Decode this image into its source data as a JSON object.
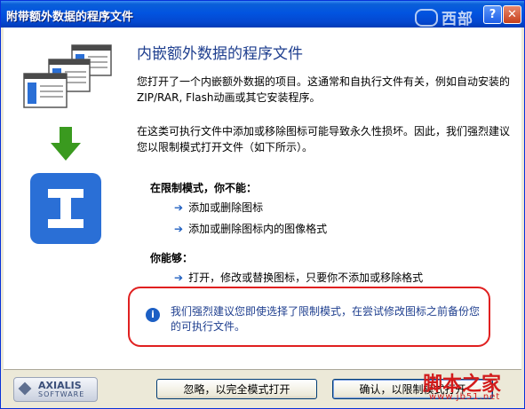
{
  "window": {
    "title": "附带额外数据的程序文件",
    "help_label": "?",
    "close_label": "✕",
    "brand": "西部"
  },
  "main": {
    "heading": "内嵌额外数据的程序文件",
    "paragraph1": "您打开了一个内嵌额外数据的项目。这通常和自执行文件有关，例如自动安装的ZIP/RAR, Flash动画或其它安装程序。",
    "paragraph2": "在这类可执行文件中添加或移除图标可能导致永久性损坏。因此，我们强烈建议您以限制模式打开文件（如下所示）。",
    "restricted_heading": "在限制模式，你不能：",
    "cannot_items": [
      "添加或删除图标",
      "添加或删除图标内的图像格式"
    ],
    "can_heading": "你能够：",
    "can_items": [
      "打开，修改或替换图标，只要你不添加或移除格式"
    ],
    "warning": "我们强烈建议您即使选择了限制模式，在尝试修改图标之前备份您的可执行文件。"
  },
  "footer": {
    "logo_line1": "AXIALIS",
    "logo_line2": "SOFTWARE",
    "ignore_button": "忽略，以完全模式打开",
    "ok_button": "确认，以限制模式打开",
    "watermark": "脚本之家",
    "watermark_sub": "www.jb51.net"
  },
  "colors": {
    "title_bar": "#0254e0",
    "heading": "#1f3f8f",
    "warning_border": "#e02020",
    "down_arrow": "#3a9a1f",
    "app_icon": "#2a6fd6"
  },
  "icons": [
    "windows-stack-icon",
    "down-arrow-icon",
    "app-i-icon",
    "info-icon",
    "arrow-right-icon"
  ]
}
